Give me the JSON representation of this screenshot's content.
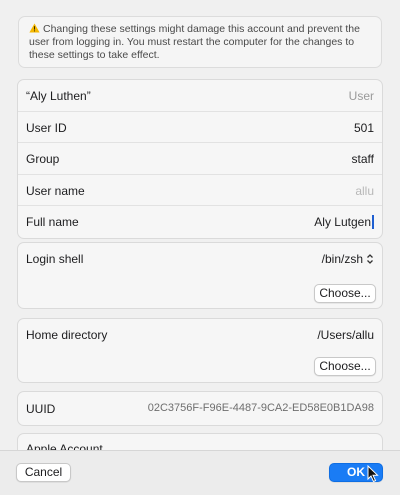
{
  "warning": {
    "text": "Changing these settings might damage this account and prevent the user from logging in. You must restart the computer for the changes to these settings to take effect.",
    "icon": "warning-icon",
    "icon_color": "#f5b800"
  },
  "identity": {
    "account_name": "“Aly Luthen”",
    "account_type": "User",
    "user_id_label": "User ID",
    "user_id": "501",
    "group_label": "Group",
    "group": "staff",
    "user_name_label": "User name",
    "user_name": "allu",
    "full_name_label": "Full name",
    "full_name": "Aly Lutgen"
  },
  "login_shell": {
    "label": "Login shell",
    "value": "/bin/zsh",
    "choose_label": "Choose..."
  },
  "home_directory": {
    "label": "Home directory",
    "value": "/Users/allu",
    "choose_label": "Choose..."
  },
  "uuid": {
    "label": "UUID",
    "value": "02C3756F-F96E-4487-9CA2-ED58E0B1DA98"
  },
  "apple_account": {
    "label": "Apple Account"
  },
  "footer": {
    "cancel_label": "Cancel",
    "ok_label": "OK"
  },
  "colors": {
    "accent": "#1a7cf5",
    "caret": "#1f5fd1"
  }
}
